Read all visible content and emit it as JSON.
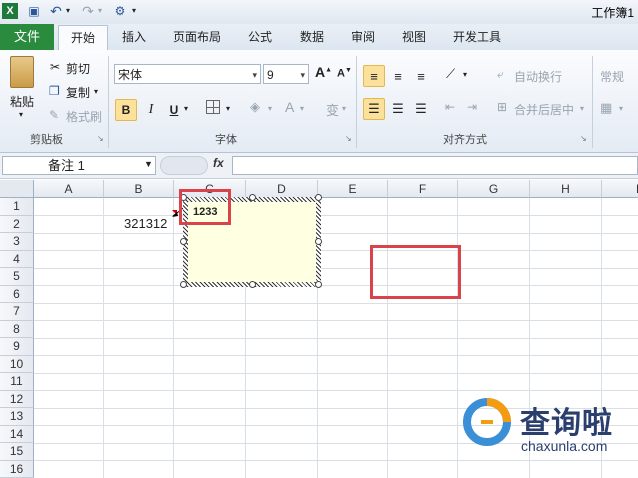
{
  "titlebar": {
    "app_title": "工作簿1",
    "quick_access": [
      {
        "icon": "excel-icon",
        "label": "X"
      },
      {
        "icon": "save-icon",
        "label": "▣"
      },
      {
        "icon": "undo-icon",
        "label": "↶"
      },
      {
        "icon": "redo-icon",
        "label": "↷"
      },
      {
        "icon": "customize-icon",
        "label": "⚙"
      }
    ]
  },
  "tabs": {
    "file": "文件",
    "items": [
      "开始",
      "插入",
      "页面布局",
      "公式",
      "数据",
      "审阅",
      "视图",
      "开发工具"
    ]
  },
  "ribbon": {
    "clipboard": {
      "paste": "粘贴",
      "cut": "剪切",
      "copy": "复制",
      "format_painter": "格式刷",
      "group_label": "剪贴板"
    },
    "font": {
      "font_name": "宋体",
      "font_size": "9",
      "bold": "B",
      "italic": "I",
      "underline": "U",
      "grow": "A",
      "shrink": "A",
      "phonetic": "变",
      "group_label": "字体"
    },
    "alignment": {
      "wrap_text": "自动换行",
      "merge_center": "合并后居中",
      "group_label": "对齐方式"
    },
    "number": {
      "format": "常规"
    }
  },
  "formula_bar": {
    "name_box": "备注 1",
    "fx": "fx",
    "formula": ""
  },
  "sheet": {
    "columns": [
      "A",
      "B",
      "C",
      "D",
      "E",
      "F",
      "G",
      "H",
      "I"
    ],
    "rows": [
      "1",
      "2",
      "3",
      "4",
      "5",
      "6",
      "7",
      "8",
      "9",
      "10",
      "11",
      "12",
      "13",
      "14",
      "15",
      "16"
    ],
    "cell_b2": "321312",
    "comment_text": "1233"
  },
  "colors": {
    "file_tab": "#2a8b3e",
    "highlight": "#d9434a",
    "comment_bg": "#ffffe1"
  }
}
